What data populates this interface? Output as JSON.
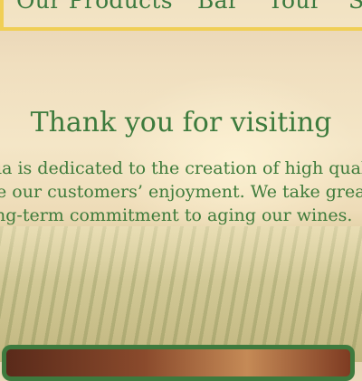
{
  "nav": {
    "items": [
      "Our Products",
      "Bar",
      "Tour",
      "Sc"
    ]
  },
  "main": {
    "title": "Thank you for visiting",
    "description": [
      "ia is dedicated to the creation of high qual",
      "e our customers’ enjoyment. We take grea",
      "ng-term commitment to aging our wines."
    ]
  },
  "colors": {
    "accent_green": "#3d7b3d",
    "nav_border": "#f0cf55"
  }
}
